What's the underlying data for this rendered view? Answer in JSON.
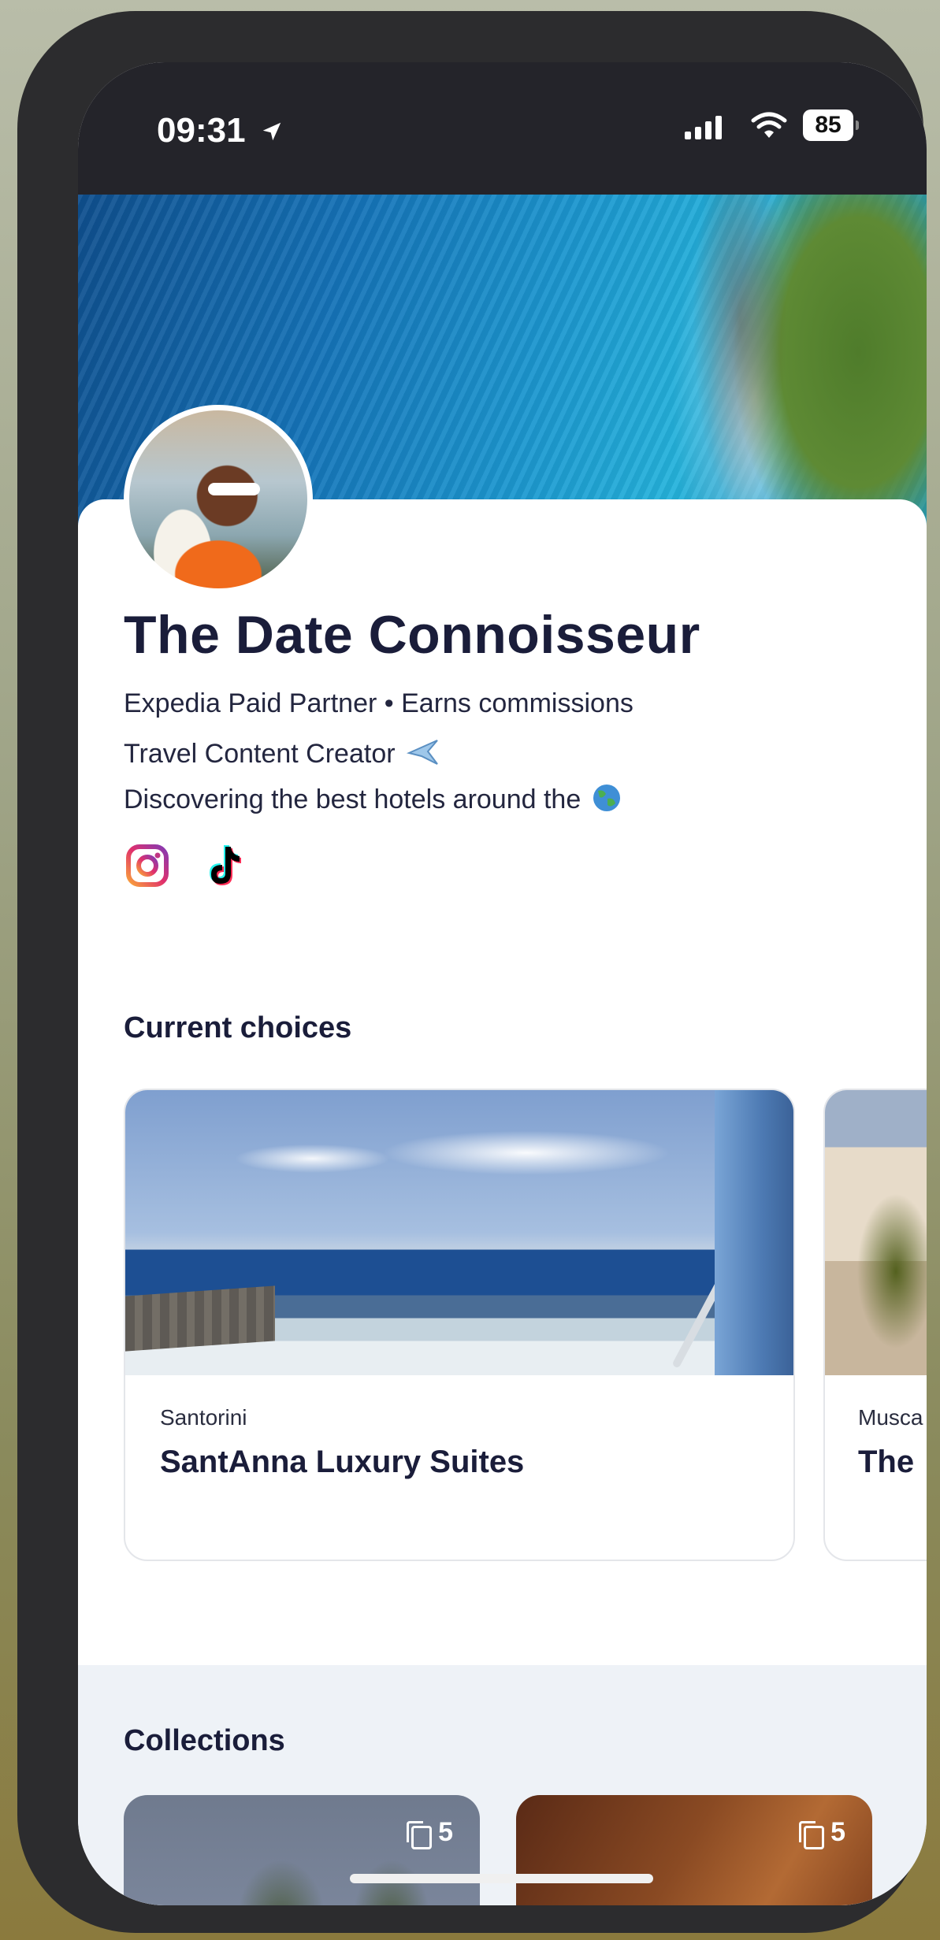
{
  "status_bar": {
    "time": "09:31",
    "battery": "85",
    "icons": [
      "location-arrow-icon",
      "signal-icon",
      "wifi-icon",
      "battery-icon"
    ]
  },
  "profile": {
    "name": "The Date Connoisseur",
    "bio_line1": "Expedia Paid Partner • Earns commissions",
    "bio_line2": "Travel Content Creator",
    "bio_line3": "Discovering the best hotels around the",
    "socials": [
      "instagram-icon",
      "tiktok-icon"
    ]
  },
  "current_choices": {
    "title": "Current choices",
    "cards": [
      {
        "location": "Santorini",
        "name": "SantAnna Luxury Suites"
      },
      {
        "location": "Musca",
        "name": "The"
      }
    ]
  },
  "collections": {
    "title": "Collections",
    "cards": [
      {
        "count": "5"
      },
      {
        "count": "5"
      }
    ]
  },
  "colors": {
    "title_text": "#1a1d3a",
    "status_bar_bg": "#24242a",
    "collections_bg": "#eef2f7"
  }
}
